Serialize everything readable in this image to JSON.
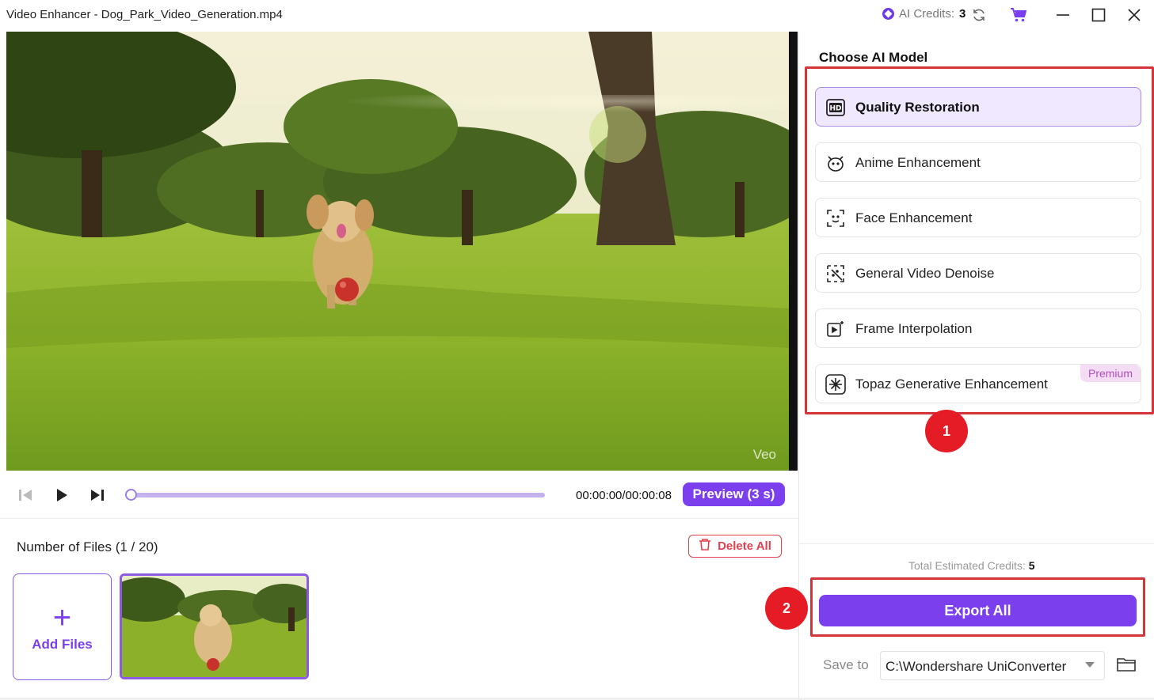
{
  "window": {
    "title": "Video Enhancer - Dog_Park_Video_Generation.mp4",
    "credits_label": "AI Credits:",
    "credits_value": "3"
  },
  "player": {
    "watermark": "Veo",
    "timecode": "00:00:00/00:00:08",
    "progress": 0,
    "preview_label": "Preview (3 s)"
  },
  "files": {
    "count_label": "Number of Files (1 / 20)",
    "delete_all_label": "Delete All",
    "add_files_label": "Add Files"
  },
  "models": {
    "title": "Choose AI Model",
    "items": [
      {
        "label": "Quality Restoration",
        "icon": "hd-icon",
        "selected": true
      },
      {
        "label": "Anime Enhancement",
        "icon": "anime-face-icon"
      },
      {
        "label": "Face Enhancement",
        "icon": "face-scan-icon"
      },
      {
        "label": "General Video Denoise",
        "icon": "denoise-icon"
      },
      {
        "label": "Frame Interpolation",
        "icon": "frame-play-icon"
      },
      {
        "label": "Topaz Generative Enhancement",
        "icon": "sparkle-icon",
        "badge": "Premium"
      }
    ]
  },
  "annotations": {
    "step1": "1",
    "step2": "2",
    "highlight_color": "#d2343a"
  },
  "export": {
    "estimated_label": "Total Estimated Credits:",
    "estimated_value": "5",
    "button_label": "Export All",
    "save_to_label": "Save to",
    "save_path": "C:\\Wondershare UniConverter"
  },
  "colors": {
    "accent": "#7b3fed",
    "danger": "#e0414f",
    "selected_bg": "#efe8ff"
  }
}
